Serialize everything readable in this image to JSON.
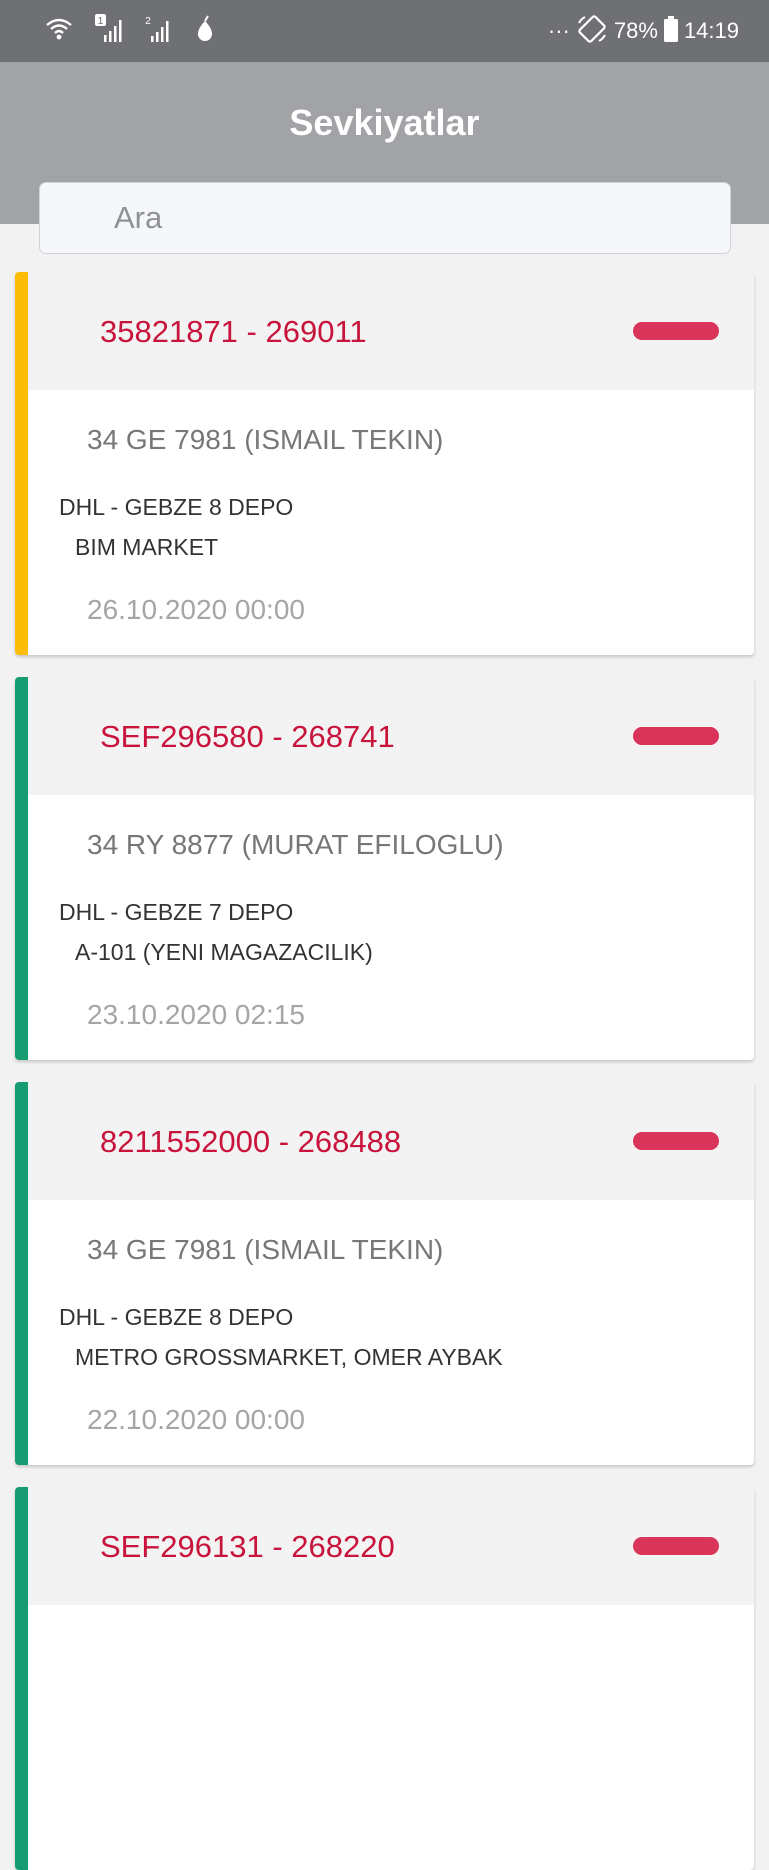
{
  "status_bar": {
    "icons": [
      "wifi-icon",
      "sim1-signal-icon",
      "sim2-signal-icon",
      "notification-drop-icon",
      "more-dots-icon",
      "rotation-icon",
      "battery-icon"
    ],
    "sim1_label": "1",
    "sim2_label": "2",
    "more": "···",
    "battery": "78%",
    "time": "14:19"
  },
  "header": {
    "title": "Sevkiyatlar",
    "color": "#a1a3a7"
  },
  "search": {
    "placeholder": "Ara"
  },
  "colors": {
    "accent_red": "#c8143c",
    "pill": "#d9345a",
    "status_yellow": "#fbbd08",
    "status_green": "#179b73"
  },
  "shipments": [
    {
      "code": "35821871 - 269011",
      "plate": "34 GE 7981 (ISMAIL TEKIN)",
      "depot": "DHL - GEBZE 8 DEPO",
      "customer": "BIM MARKET",
      "date": "26.10.2020 00:00",
      "status_color": "#fbbd08"
    },
    {
      "code": "SEF296580 - 268741",
      "plate": "34 RY 8877 (MURAT EFILOGLU)",
      "depot": "DHL - GEBZE 7 DEPO",
      "customer": "A-101 (YENI MAGAZACILIK)",
      "date": "23.10.2020 02:15",
      "status_color": "#179b73"
    },
    {
      "code": "8211552000 - 268488",
      "plate": "34 GE 7981 (ISMAIL TEKIN)",
      "depot": "DHL - GEBZE 8 DEPO",
      "customer": "METRO GROSSMARKET, OMER AYBAK",
      "date": "22.10.2020 00:00",
      "status_color": "#179b73"
    },
    {
      "code": "SEF296131 - 268220",
      "plate": "",
      "depot": "",
      "customer": "",
      "date": "",
      "status_color": "#179b73"
    }
  ]
}
